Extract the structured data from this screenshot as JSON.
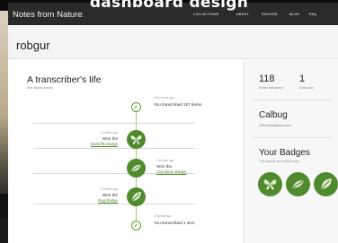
{
  "caption": "dashboard design",
  "header": {
    "brand": "Notes from Nature",
    "brand_dot": ".",
    "nav": [
      "COLLECTIONS",
      "ABOUT",
      "DISCUSS",
      "BLOG",
      "FAQ"
    ]
  },
  "profile": {
    "username": "robgur"
  },
  "timeline": {
    "title": "A transcriber's life",
    "subtitle": "See Skyllie activity",
    "events": [
      {
        "time": "a few hours ago",
        "text": "You transcribed 157 items",
        "icon": "check-icon"
      },
      {
        "time": "2 months ago",
        "text": "Won the",
        "badge": "Butterfly Badge",
        "icon": "butterfly-icon"
      },
      {
        "time": "2 months ago",
        "text": "Won the",
        "badge": "Cicindelor Badge",
        "icon": "beetle-icon"
      },
      {
        "time": "2 months ago",
        "text": "Won the",
        "badge": "Bug Badge",
        "icon": "leaf-icon"
      },
      {
        "time": "2 months ago",
        "text": "You transcribed 1 item",
        "icon": "check-icon"
      }
    ]
  },
  "sidebar": {
    "stats": [
      {
        "value": "118",
        "label": "Entries transcribed"
      },
      {
        "value": "1",
        "label": "Collections"
      }
    ],
    "collection": {
      "title": "Calbug",
      "detail": "118 transcriptions done"
    },
    "badges_title": "Your Badges",
    "badges_subtitle": "The rewards we've earned you",
    "badges": [
      "butterfly-icon",
      "beetle-icon",
      "leaf-icon"
    ]
  },
  "colors": {
    "accent": "#4f8a2e",
    "topbar": "#2a2a2a"
  }
}
